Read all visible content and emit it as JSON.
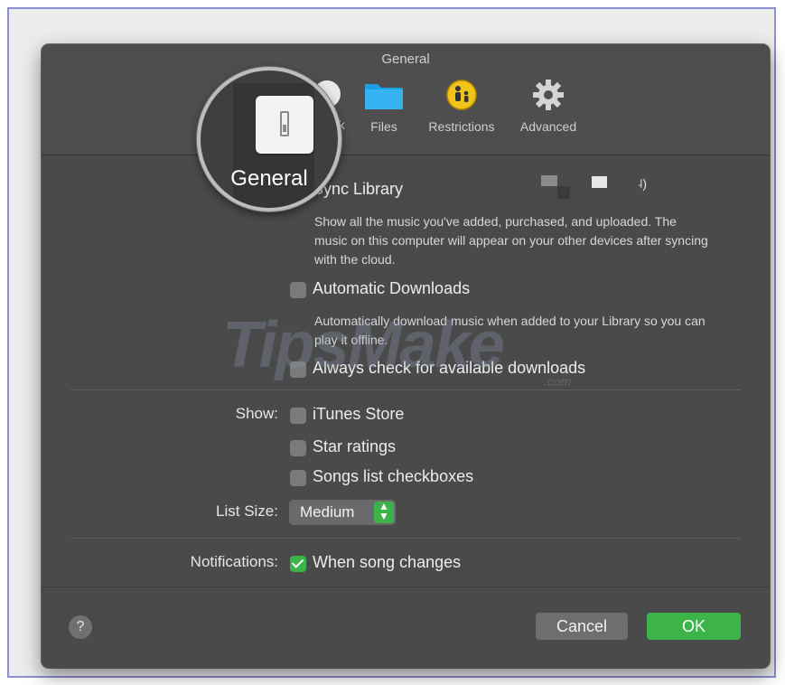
{
  "window": {
    "title": "General"
  },
  "toolbar": {
    "tabs": [
      {
        "label": "General",
        "icon": "general-switch-icon",
        "selected": true
      },
      {
        "label": "Playback",
        "visible_text": "ack",
        "icon": "playback-icon"
      },
      {
        "label": "Files",
        "icon": "folder-icon"
      },
      {
        "label": "Restrictions",
        "icon": "parental-restrictions-icon"
      },
      {
        "label": "Advanced",
        "icon": "gear-icon"
      }
    ]
  },
  "magnifier": {
    "label": "General"
  },
  "library": {
    "sync_label": "Sync Library",
    "sync_checked": true,
    "sync_desc": "Show all the music you've added, purchased, and uploaded. The music on this computer will appear on your other devices after syncing with the cloud.",
    "auto_downloads_label": "Automatic Downloads",
    "auto_downloads_checked": false,
    "auto_downloads_desc": "Automatically download music when added to your Library so you can play it offline.",
    "always_check_label": "Always check for available downloads",
    "always_check_checked": false
  },
  "show": {
    "label": "Show:",
    "options": [
      {
        "label": "iTunes Store",
        "checked": false
      },
      {
        "label": "Star ratings",
        "checked": false
      },
      {
        "label": "Songs list checkboxes",
        "checked": false
      }
    ]
  },
  "list_size": {
    "label": "List Size:",
    "value": "Medium"
  },
  "notifications": {
    "label": "Notifications:",
    "option": "When song changes",
    "checked": true
  },
  "buttons": {
    "cancel": "Cancel",
    "ok": "OK",
    "help": "?"
  },
  "watermark": {
    "text": "TipsMake",
    "domain": ".com"
  },
  "colors": {
    "accent_green": "#3cb44a",
    "window_bg": "#4a4a4a",
    "frame_border": "#8c8fd0",
    "restrictions_yellow": "#f0c419",
    "files_blue": "#1e9ee6"
  }
}
